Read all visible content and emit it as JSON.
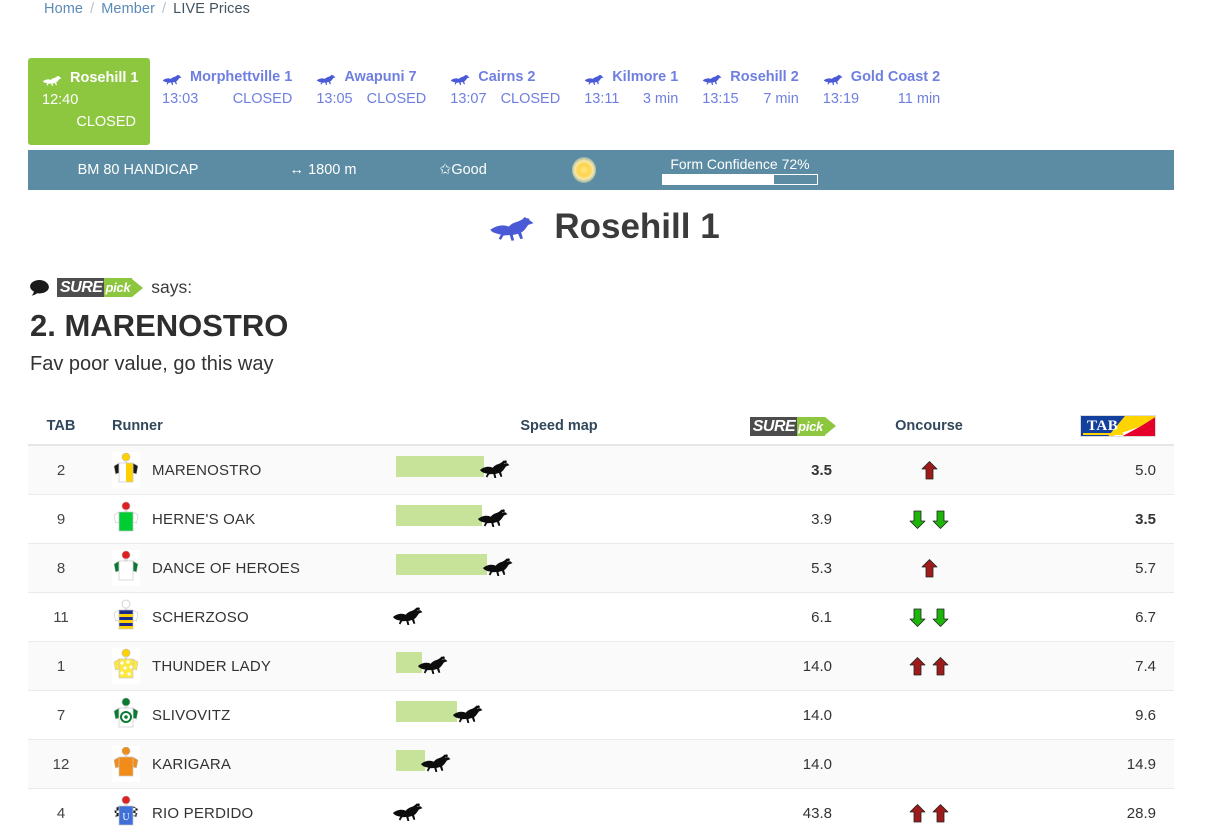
{
  "breadcrumb": {
    "home": "Home",
    "member": "Member",
    "current": "LIVE Prices",
    "separator": "/"
  },
  "race_tabs": [
    {
      "name": "Rosehill 1",
      "time": "12:40",
      "status": "CLOSED",
      "active": true
    },
    {
      "name": "Morphettville 1",
      "time": "13:03",
      "status": "CLOSED",
      "active": false
    },
    {
      "name": "Awapuni 7",
      "time": "13:05",
      "status": "CLOSED",
      "active": false
    },
    {
      "name": "Cairns 2",
      "time": "13:07",
      "status": "CLOSED",
      "active": false
    },
    {
      "name": "Kilmore 1",
      "time": "13:11",
      "status": "3 min",
      "active": false
    },
    {
      "name": "Rosehill 2",
      "time": "13:15",
      "status": "7 min",
      "active": false
    },
    {
      "name": "Gold Coast 2",
      "time": "13:19",
      "status": "11 min",
      "active": false
    }
  ],
  "race_info": {
    "class": "BM 80 HANDICAP",
    "distance": "1800 m",
    "going": "Good",
    "weather_icon": "sun-icon",
    "form_confidence_label": "Form Confidence 72%",
    "form_confidence_pct": 72
  },
  "meeting": {
    "title": "Rosehill 1",
    "icon": "horse-racing-icon"
  },
  "surepick_says": {
    "logo_part1": "SURE",
    "logo_part2": "pick",
    "says_label": "says:",
    "selection": "2. MARENOSTRO",
    "comment": "Fav poor value, go this way"
  },
  "table": {
    "headers": {
      "tab": "TAB",
      "runner": "Runner",
      "speed_map": "Speed map",
      "surepick": "SUREpick",
      "oncourse": "Oncourse",
      "tab_odds": "TAB"
    },
    "rows": [
      {
        "tab": "2",
        "runner": "MARENOSTRO",
        "speed_bar_pct": 68,
        "horse_left_pct": 68,
        "surepick": "3.5",
        "surepick_bold": true,
        "arrows": [
          "up"
        ],
        "tab_odds": "5.0",
        "tab_bold": false
      },
      {
        "tab": "9",
        "runner": "HERNE'S OAK",
        "speed_bar_pct": 66,
        "horse_left_pct": 66,
        "surepick": "3.9",
        "surepick_bold": false,
        "arrows": [
          "down",
          "down"
        ],
        "tab_odds": "3.5",
        "tab_bold": true
      },
      {
        "tab": "8",
        "runner": "DANCE OF HEROES",
        "speed_bar_pct": 70,
        "horse_left_pct": 70,
        "surepick": "5.3",
        "surepick_bold": false,
        "arrows": [
          "up"
        ],
        "tab_odds": "5.7",
        "tab_bold": false
      },
      {
        "tab": "11",
        "runner": "SCHERZOSO",
        "speed_bar_pct": 0,
        "horse_left_pct": 1,
        "surepick": "6.1",
        "surepick_bold": false,
        "arrows": [
          "down",
          "down"
        ],
        "tab_odds": "6.7",
        "tab_bold": false
      },
      {
        "tab": "1",
        "runner": "THUNDER LADY",
        "speed_bar_pct": 20,
        "horse_left_pct": 20,
        "surepick": "14.0",
        "surepick_bold": false,
        "arrows": [
          "up",
          "up"
        ],
        "tab_odds": "7.4",
        "tab_bold": false
      },
      {
        "tab": "7",
        "runner": "SLIVOVITZ",
        "speed_bar_pct": 47,
        "horse_left_pct": 47,
        "surepick": "14.0",
        "surepick_bold": false,
        "arrows": [],
        "tab_odds": "9.6",
        "tab_bold": false
      },
      {
        "tab": "12",
        "runner": "KARIGARA",
        "speed_bar_pct": 22,
        "horse_left_pct": 22,
        "surepick": "14.0",
        "surepick_bold": false,
        "arrows": [],
        "tab_odds": "14.9",
        "tab_bold": false
      },
      {
        "tab": "4",
        "runner": "RIO PERDIDO",
        "speed_bar_pct": 0,
        "horse_left_pct": 1,
        "surepick": "43.8",
        "surepick_bold": false,
        "arrows": [
          "up",
          "up"
        ],
        "tab_odds": "28.9",
        "tab_bold": false
      }
    ],
    "silks": [
      {
        "runner": "MARENOSTRO",
        "cap": "#ffd100",
        "body": "#ffd100",
        "body_alt": "#ffffff",
        "sleeves": "#1a1a1a",
        "pattern": "halved"
      },
      {
        "runner": "HERNE'S OAK",
        "cap": "#e02020",
        "body": "#00cc33",
        "body_alt": "#00cc33",
        "sleeves": "#ffffff",
        "pattern": "solid"
      },
      {
        "runner": "DANCE OF HEROES",
        "cap": "#e02020",
        "body": "#ffffff",
        "body_alt": "#ffffff",
        "sleeves": "#0a7a33",
        "pattern": "solid"
      },
      {
        "runner": "SCHERZOSO",
        "cap": "#ffffff",
        "body": "#1a2a8a",
        "body_alt": "#ffd100",
        "sleeves": "#ffffff",
        "pattern": "hooped"
      },
      {
        "runner": "THUNDER LADY",
        "cap": "#ffd100",
        "body": "#ffe83d",
        "body_alt": "#ffffff",
        "sleeves": "#ffe83d",
        "pattern": "spotted"
      },
      {
        "runner": "SLIVOVITZ",
        "cap": "#0a7a33",
        "body": "#ffffff",
        "body_alt": "#0a7a33",
        "sleeves": "#0a7a33",
        "pattern": "disc"
      },
      {
        "runner": "KARIGARA",
        "cap": "#f28c18",
        "body": "#f28c18",
        "body_alt": "#f28c18",
        "sleeves": "#f28c18",
        "pattern": "solid"
      },
      {
        "runner": "RIO PERDIDO",
        "cap": "#e02020",
        "body": "#3f6fd8",
        "body_alt": "#ffffff",
        "sleeves": "#1a1a1a",
        "pattern": "checked"
      }
    ]
  },
  "colors": {
    "accent_green": "#8dc63f",
    "speed_bar": "#c7e39a",
    "info_bar": "#5b8ca3",
    "tab_link": "#6f7fe0",
    "arrow_up": "#9e1b1b",
    "arrow_down": "#1eb40a"
  }
}
